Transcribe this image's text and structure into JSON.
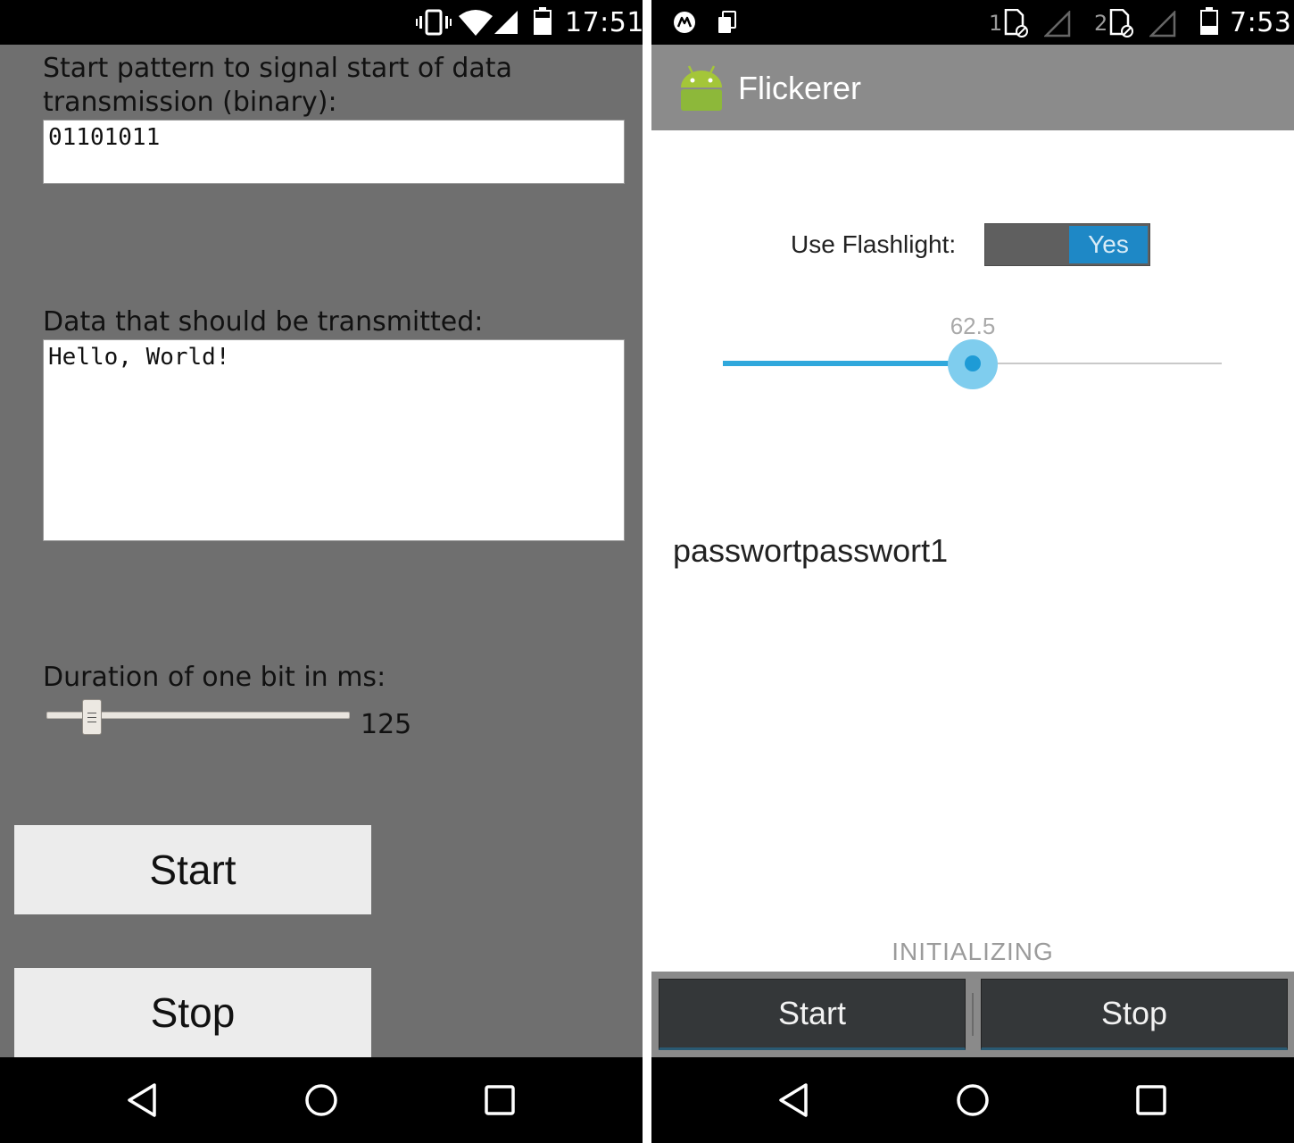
{
  "left": {
    "status_time": "17:51",
    "start_pattern_label": "Start pattern to signal start of data transmission (binary):",
    "start_pattern_value": "01101011",
    "data_label": "Data that should be transmitted:",
    "data_value": "Hello, World!",
    "duration_label": "Duration of one bit in ms:",
    "duration_value": "125",
    "start_button": "Start",
    "stop_button": "Stop"
  },
  "right": {
    "status_time": "7:53",
    "sim1_label": "1",
    "sim2_label": "2",
    "app_title": "Flickerer",
    "flashlight_label": "Use Flashlight:",
    "flashlight_toggle": "Yes",
    "seek_value_text": "62.5",
    "seek_fraction": 0.5,
    "password_text": "passwortpasswort1",
    "state_text": "INITIALIZING",
    "start_button": "Start",
    "stop_button": "Stop"
  },
  "colors": {
    "left_background": "#6f6f6f",
    "action_bar": "#8b8b8b",
    "accent_blue": "#1e88c6",
    "seek_fill": "#30a8dc",
    "android_green": "#a4c639"
  },
  "icons": [
    "vibrate-icon",
    "wifi-icon",
    "cell-signal-icon",
    "battery-icon",
    "motorola-icon",
    "sim-status-icon",
    "sim-card-icon",
    "android-robot-icon",
    "back-icon",
    "home-icon",
    "recents-icon"
  ]
}
